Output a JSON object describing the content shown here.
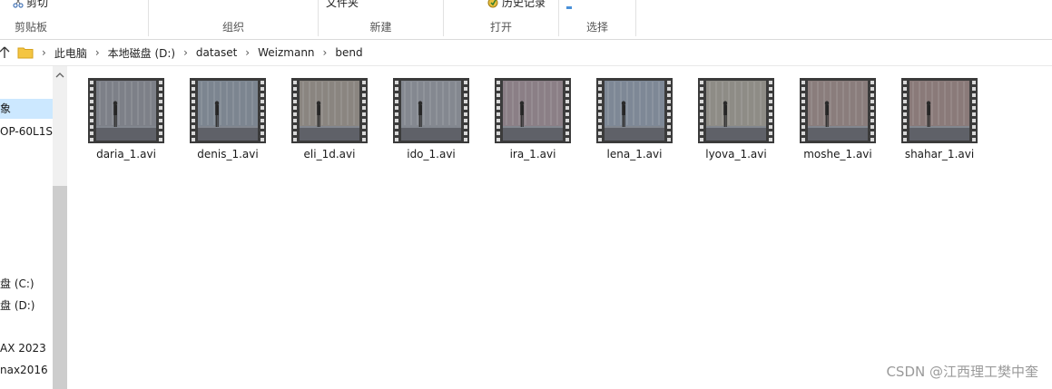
{
  "ribbon": {
    "clipboard_cut": "剪切",
    "group_clipboard": "剪贴板",
    "group_organize": "组织",
    "new_item_partial": "文件夹",
    "group_new": "新建",
    "history_partial": "历史记录",
    "group_open": "打开",
    "group_select": "选择"
  },
  "address": {
    "crumbs": [
      "此电脑",
      "本地磁盘 (D:)",
      "dataset",
      "Weizmann",
      "bend"
    ]
  },
  "nav": {
    "items": [
      {
        "label": "象",
        "selected": true
      },
      {
        "label": "OP-60L1S",
        "selected": false
      },
      {
        "label": "盘 (C:)",
        "selected": false
      },
      {
        "label": "盘 (D:)",
        "selected": false
      },
      {
        "label": "AX 2023",
        "selected": false
      },
      {
        "label": "nax2016",
        "selected": false
      }
    ]
  },
  "files": [
    {
      "name": "daria_1.avi",
      "tint": "#7d8088"
    },
    {
      "name": "denis_1.avi",
      "tint": "#7c8590"
    },
    {
      "name": "eli_1d.avi",
      "tint": "#8a8580"
    },
    {
      "name": "ido_1.avi",
      "tint": "#848890"
    },
    {
      "name": "ira_1.avi",
      "tint": "#8b7f86"
    },
    {
      "name": "lena_1.avi",
      "tint": "#7e8896"
    },
    {
      "name": "lyova_1.avi",
      "tint": "#8e8c86"
    },
    {
      "name": "moshe_1.avi",
      "tint": "#8a7d7c"
    },
    {
      "name": "shahar_1.avi",
      "tint": "#8a7a79"
    }
  ],
  "watermark": "CSDN @江西理工樊中奎"
}
